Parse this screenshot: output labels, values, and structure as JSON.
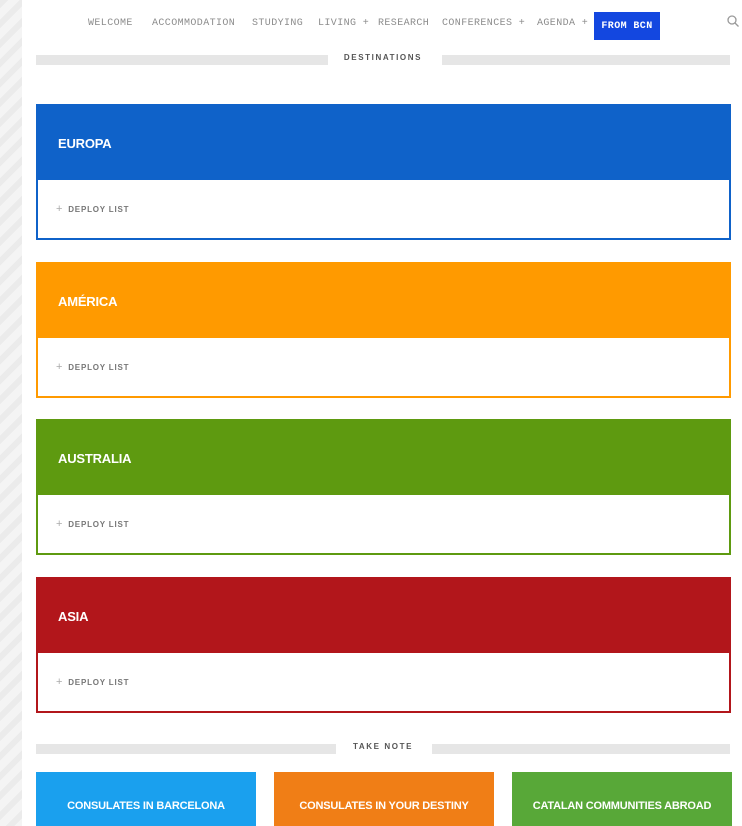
{
  "nav": {
    "items": [
      "WELCOME",
      "ACCOMMODATION",
      "STUDYING",
      "LIVING +",
      "RESEARCH",
      "CONFERENCES +",
      "AGENDA +"
    ],
    "active": "FROM BCN"
  },
  "sections": {
    "destinations": "DESTINATIONS",
    "take_note": "TAKE NOTE"
  },
  "regions": [
    {
      "name": "EUROPA",
      "color": "#0f62c9",
      "deploy": "DEPLOY LIST"
    },
    {
      "name": "AMÉRICA",
      "color": "#ff9a00",
      "deploy": "DEPLOY LIST"
    },
    {
      "name": "AUSTRALIA",
      "color": "#5e9a10",
      "deploy": "DEPLOY LIST"
    },
    {
      "name": "ASIA",
      "color": "#b2161b",
      "deploy": "DEPLOY LIST"
    }
  ],
  "tiles": [
    {
      "label": "CONSULATES IN BARCELONA",
      "color": "#1aa0ee"
    },
    {
      "label": "CONSULATES IN YOUR DESTINY",
      "color": "#f07e16"
    },
    {
      "label": "CATALAN COMMUNITIES ABROAD",
      "color": "#58a838"
    }
  ],
  "icons": {
    "search": "search-icon",
    "expand": "plus-icon"
  }
}
